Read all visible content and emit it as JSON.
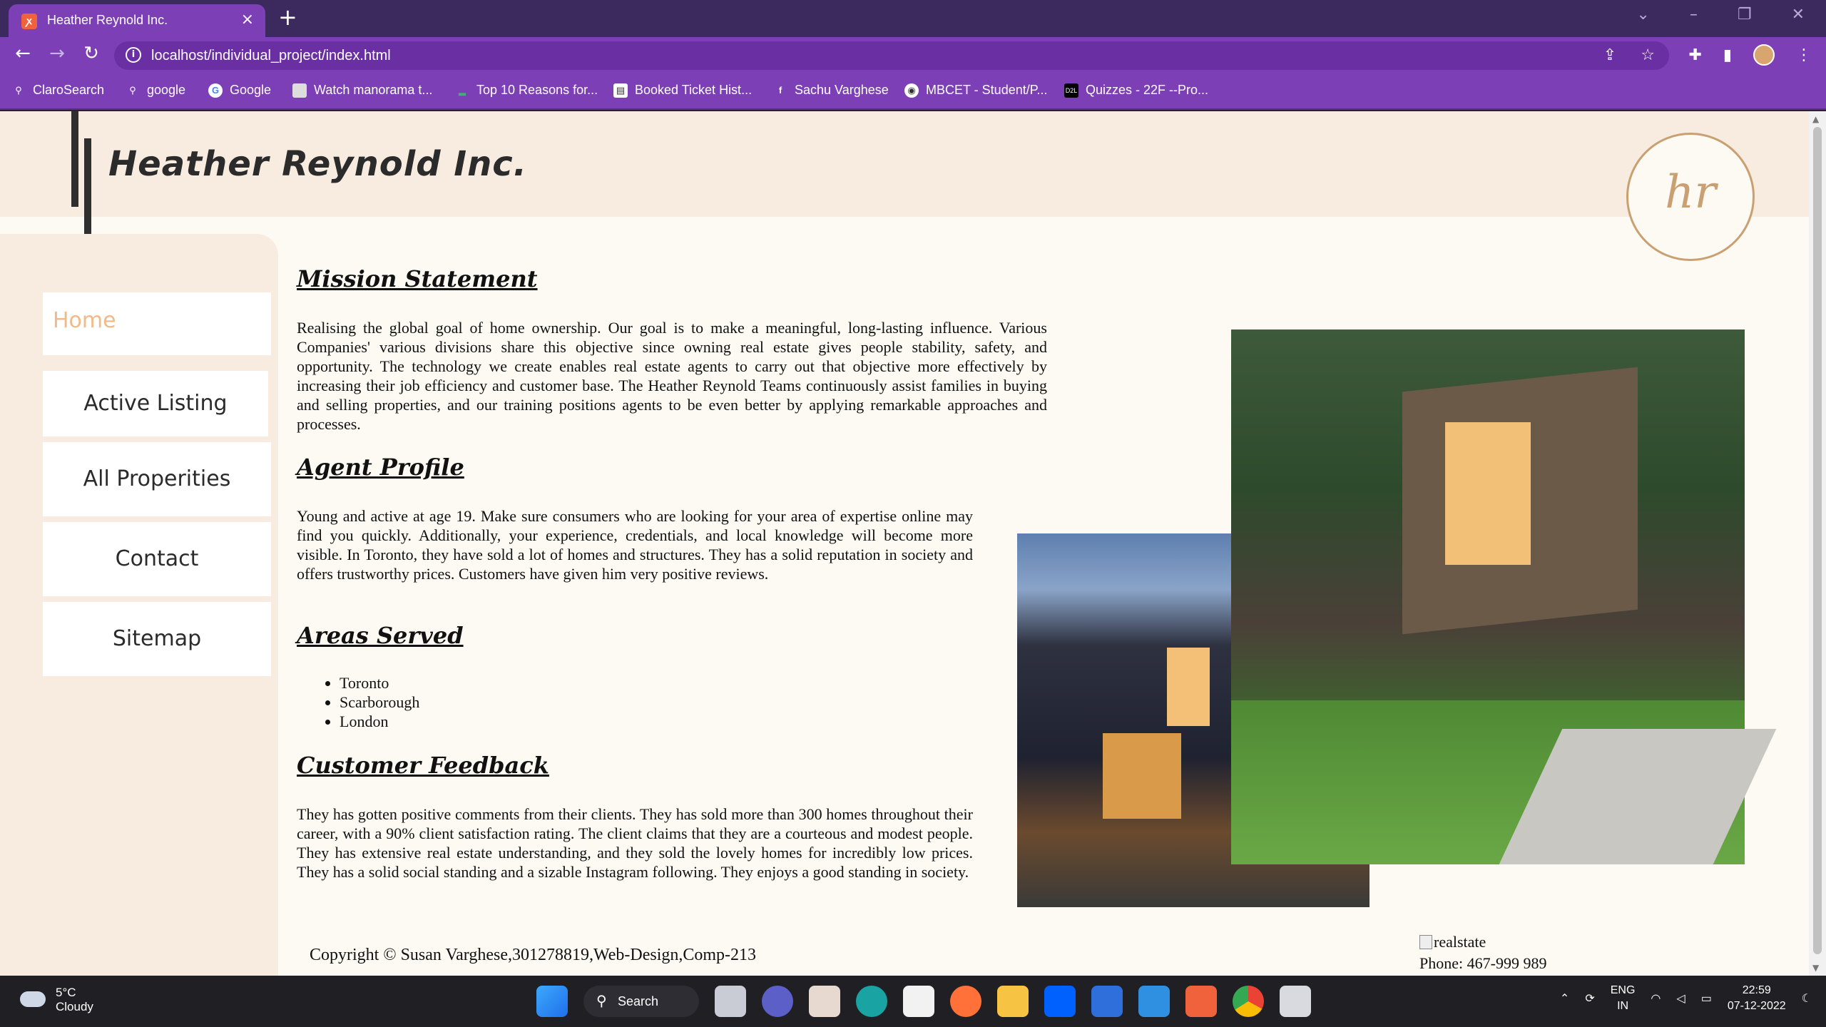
{
  "browser": {
    "tab_title": "Heather Reynold Inc.",
    "tab_close": "×",
    "new_tab": "+",
    "url": "localhost/individual_project/index.html",
    "bookmarks": [
      {
        "label": "ClaroSearch",
        "icon": "search-icon"
      },
      {
        "label": "google",
        "icon": "search-icon"
      },
      {
        "label": "Google",
        "icon": "google-icon"
      },
      {
        "label": "Watch manorama t...",
        "icon": "tv-icon"
      },
      {
        "label": "Top 10 Reasons for...",
        "icon": "leaf-icon"
      },
      {
        "label": "Booked Ticket Hist...",
        "icon": "ticket-icon"
      },
      {
        "label": "Sachu Varghese",
        "icon": "facebook-icon"
      },
      {
        "label": "MBCET - Student/P...",
        "icon": "globe-icon"
      },
      {
        "label": "Quizzes - 22F --Pro...",
        "icon": "d2l-icon"
      }
    ]
  },
  "site": {
    "title": "Heather Reynold Inc.",
    "logo_monogram": "hr",
    "nav": [
      "Home",
      "Active Listing",
      "All Properities",
      "Contact",
      "Sitemap"
    ],
    "sections": {
      "mission_heading": "Mission Statement",
      "mission_text": "Realising the global goal of home ownership. Our goal is to make a meaningful, long-lasting influence. Various Companies' various divisions share this objective since owning real estate gives people stability, safety, and opportunity. The technology we create enables real estate agents to carry out that objective more effectively by increasing their job efficiency and customer base. The Heather Reynold Teams continuously assist families in buying and selling properties, and our training positions agents to be even better by applying remarkable approaches and processes.",
      "agent_heading": "Agent Profile",
      "agent_text": "Young and active at age 19. Make sure consumers who are looking for your area of expertise online may find you quickly. Additionally, your experience, credentials, and local knowledge will become more visible. In Toronto, they have sold a lot of homes and structures. They has a solid reputation in society and offers trustworthy prices. Customers have given him very positive reviews.",
      "areas_heading": "Areas Served",
      "areas": [
        "Toronto",
        "Scarborough",
        "London"
      ],
      "feedback_heading": "Customer Feedback",
      "feedback_text": "They has gotten positive comments from their clients. They has sold more than 300 homes throughout their career, with a 90% client satisfaction rating. The client claims that they are a courteous and modest people. They has extensive real estate understanding, and they sold the lovely homes for incredibly low prices. They has a solid social standing and a sizable Instagram following. They enjoys a good standing in society."
    },
    "footer": {
      "copyright": "Copyright © Susan Varghese,301278819,Web-Design,Comp-213",
      "image_alt": "realstate",
      "phone": "Phone: 467-999 989"
    }
  },
  "taskbar": {
    "temp": "5°C",
    "condition": "Cloudy",
    "search_label": "Search",
    "lang_top": "ENG",
    "lang_bottom": "IN",
    "time": "22:59",
    "date": "07-12-2022"
  }
}
